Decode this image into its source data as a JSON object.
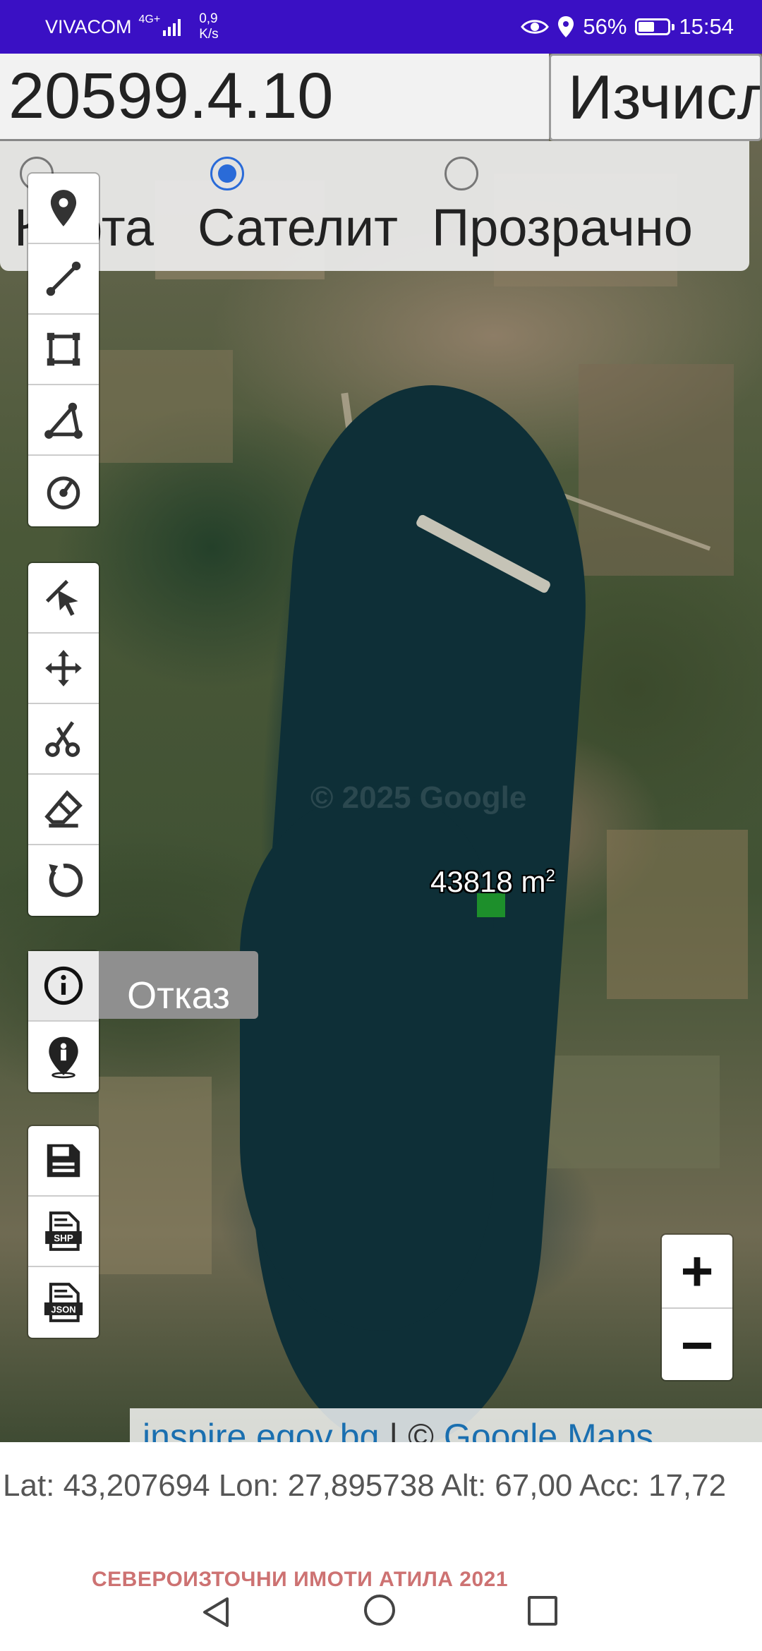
{
  "status_bar": {
    "carrier": "VIVACOM",
    "network": "4G+",
    "speed_value": "0,9",
    "speed_unit": "K/s",
    "battery": "56%",
    "battery_level": 0.56,
    "time": "15:54"
  },
  "search": {
    "value": "20599.4.10",
    "calculate_label": "Изчисли"
  },
  "map_type": {
    "options": [
      "Карта",
      "Сателит",
      "Прозрачно"
    ],
    "selected": "Сателит"
  },
  "draw_tools": [
    "marker-tool",
    "line-tool",
    "rectangle-tool",
    "polygon-tool",
    "circle-tool"
  ],
  "edit_tools": [
    "select-tool",
    "move-tool",
    "cut-tool",
    "erase-tool",
    "rotate-tool"
  ],
  "info": {
    "cancel_label": "Отказ"
  },
  "file_tools": [
    "save-icon",
    "shp-export-icon",
    "json-export-icon"
  ],
  "file_labels": {
    "shp": "SHP",
    "json": "JSON"
  },
  "map": {
    "area_value": "43818 m",
    "area_unit_exp": "2",
    "watermark": "© 2025 Google",
    "attribution": {
      "source": "inspire.egov.bg",
      "separator": " | © ",
      "provider": "Google Maps"
    }
  },
  "zoom": {
    "in": "+",
    "out": "−"
  },
  "location": {
    "text": "Lat: 43,207694 Lon: 27,895738 Alt: 67,00 Acc: 17,72"
  },
  "brand": "СЕВЕРОИЗТОЧНИ ИМОТИ АТИЛА 2021",
  "colors": {
    "status_bar": "#3a10c4",
    "radio_selected": "#2a6bd8",
    "brand_text": "#cd7272",
    "link": "#1a6fb0"
  }
}
